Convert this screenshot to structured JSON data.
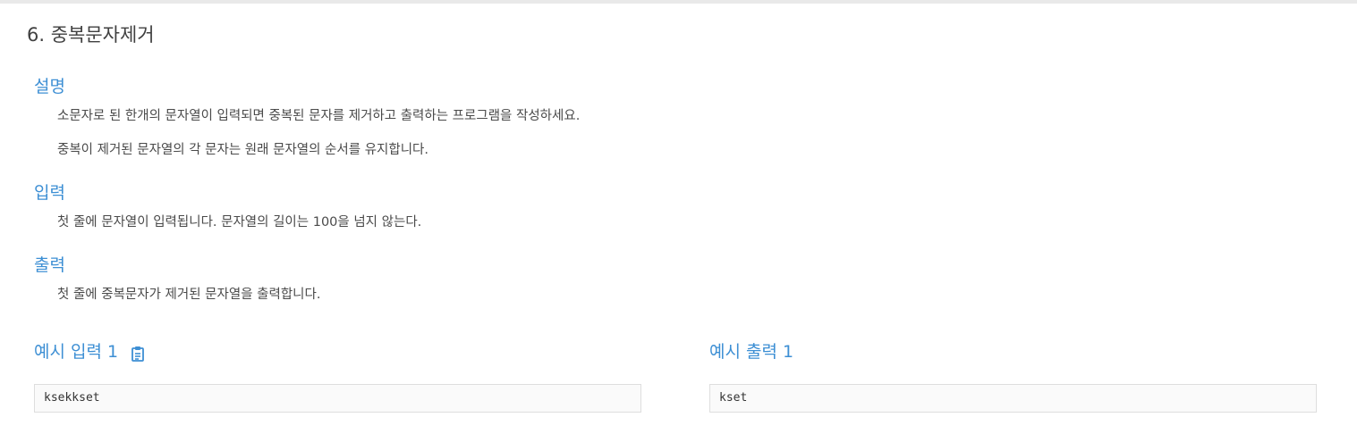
{
  "problem": {
    "title": "6. 중복문자제거"
  },
  "sections": {
    "description": {
      "heading": "설명",
      "lines": [
        "소문자로 된 한개의 문자열이 입력되면 중복된 문자를 제거하고 출력하는 프로그램을 작성하세요.",
        "중복이 제거된 문자열의 각 문자는 원래 문자열의 순서를 유지합니다."
      ]
    },
    "input": {
      "heading": "입력",
      "lines": [
        "첫 줄에 문자열이 입력됩니다. 문자열의 길이는 100을 넘지 않는다."
      ]
    },
    "output": {
      "heading": "출력",
      "lines": [
        "첫 줄에 중복문자가 제거된 문자열을 출력합니다."
      ]
    }
  },
  "examples": {
    "input": {
      "heading": "예시 입력 1",
      "copy_icon": "clipboard-icon",
      "value": "ksekkset"
    },
    "output": {
      "heading": "예시 출력 1",
      "value": "kset"
    }
  },
  "colors": {
    "accent": "#3d8fd4",
    "text": "#4a4a4a",
    "box_border": "#dedede",
    "box_bg": "#fafafa"
  }
}
